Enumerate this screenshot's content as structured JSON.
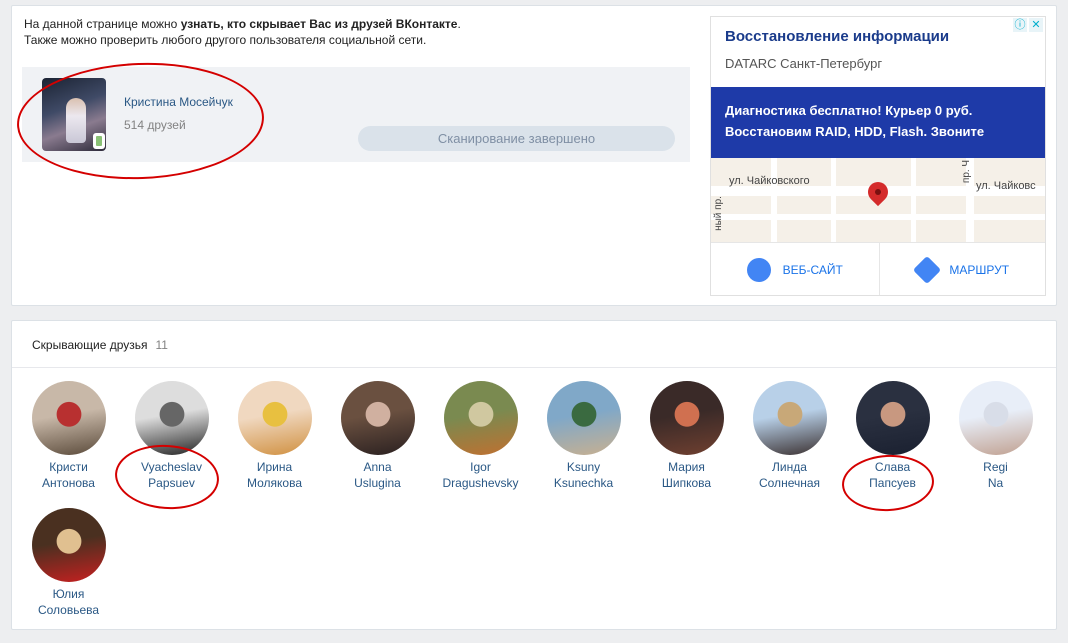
{
  "intro": {
    "line1_start": "На данной странице можно ",
    "line1_bold": "узнать, кто скрывает Вас из друзей ВКонтакте",
    "line1_end": ".",
    "line2": "Также можно проверить любого другого пользователя социальной сети."
  },
  "profile": {
    "name": "Кристина Мосейчук",
    "friends": "514 друзей",
    "scan_status": "Сканирование завершено"
  },
  "ad": {
    "title": "Восстановление информации",
    "subtitle": "DATARC Санкт-Петербург",
    "banner_line1": "Диагностика бесплатно! Курьер 0 руб.",
    "banner_line2": "Восстановим RAID, HDD, Flash. Звоните",
    "map_street_left": "ул. Чайковского",
    "map_street_right": "ул. Чайковс",
    "map_vertical_left": "ный пр.",
    "map_vertical_right": "пр. Ч",
    "website_label": "ВЕБ-САЙТ",
    "route_label": "МАРШРУТ",
    "info_icon": "ⓘ",
    "close_icon": "✕"
  },
  "hiding": {
    "title": "Скрывающие друзья",
    "count": "11",
    "friends": [
      {
        "first": "Кристи",
        "last": "Антонова",
        "colors": [
          "#c8b8a8",
          "#b83030",
          "#5a4a3a"
        ]
      },
      {
        "first": "Vyacheslav",
        "last": "Papsuev",
        "colors": [
          "#dddddd",
          "#666666",
          "#222222"
        ]
      },
      {
        "first": "Ирина",
        "last": "Молякова",
        "colors": [
          "#f0d8c0",
          "#e8c040",
          "#d09040"
        ]
      },
      {
        "first": "Anna",
        "last": "Uslugina",
        "colors": [
          "#6a5040",
          "#d0b0a0",
          "#2a2020"
        ]
      },
      {
        "first": "Igor",
        "last": "Dragushevsky",
        "colors": [
          "#7a8a50",
          "#d0c8a0",
          "#c07030"
        ]
      },
      {
        "first": "Ksuny",
        "last": "Ksunechka",
        "colors": [
          "#80a8c8",
          "#3a6a40",
          "#c8b090"
        ]
      },
      {
        "first": "Мария",
        "last": "Шипкова",
        "colors": [
          "#3a2a28",
          "#d07050",
          "#704030"
        ]
      },
      {
        "first": "Линда",
        "last": "Солнечная",
        "colors": [
          "#b8d0e8",
          "#c8a878",
          "#3a3030"
        ]
      },
      {
        "first": "Слава",
        "last": "Папсуев",
        "colors": [
          "#2a3040",
          "#c89880",
          "#1a2030"
        ]
      },
      {
        "first": "Regi",
        "last": "Na",
        "colors": [
          "#e8eef8",
          "#d8dde8",
          "#c0a090"
        ]
      },
      {
        "first": "Юлия",
        "last": "Соловьева",
        "colors": [
          "#4a3020",
          "#e0c090",
          "#c82020"
        ]
      }
    ]
  }
}
